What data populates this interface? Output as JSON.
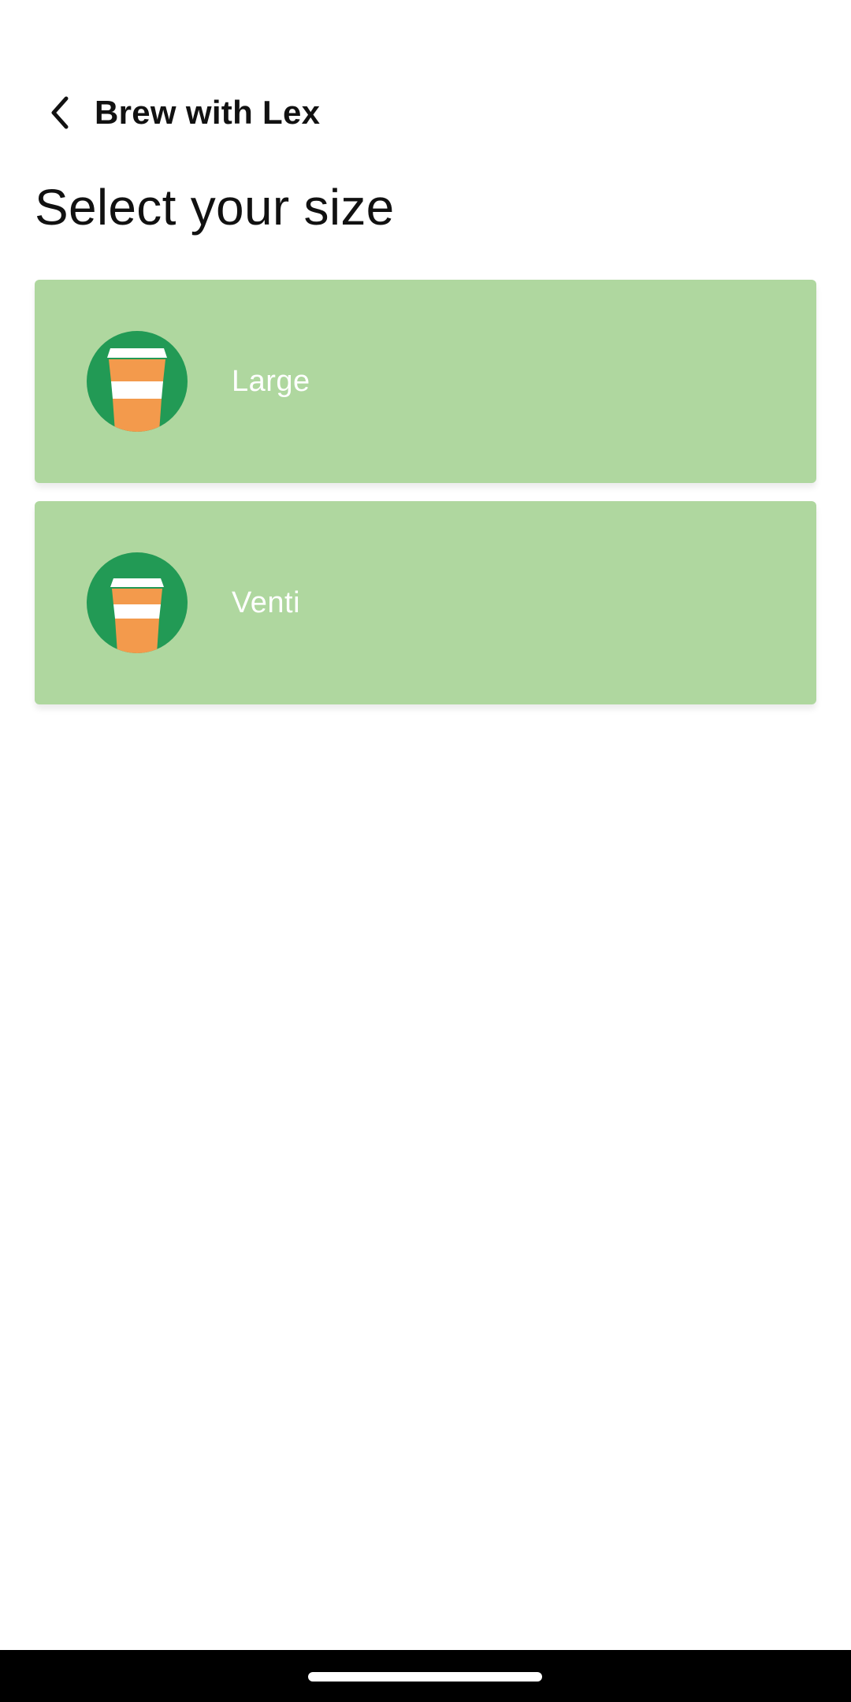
{
  "header": {
    "back_icon": "chevron-left-icon",
    "app_title": "Brew with Lex"
  },
  "page": {
    "title": "Select your size"
  },
  "sizes": [
    {
      "label": "Large",
      "icon": "coffee-cup-icon"
    },
    {
      "label": "Venti",
      "icon": "coffee-cup-icon"
    }
  ],
  "colors": {
    "card_bg": "#afd79f",
    "avatar_bg": "#229a55",
    "cup_orange": "#f39a4c",
    "cup_white": "#ffffff",
    "text_dark": "#111111",
    "nav_bar": "#000000"
  }
}
